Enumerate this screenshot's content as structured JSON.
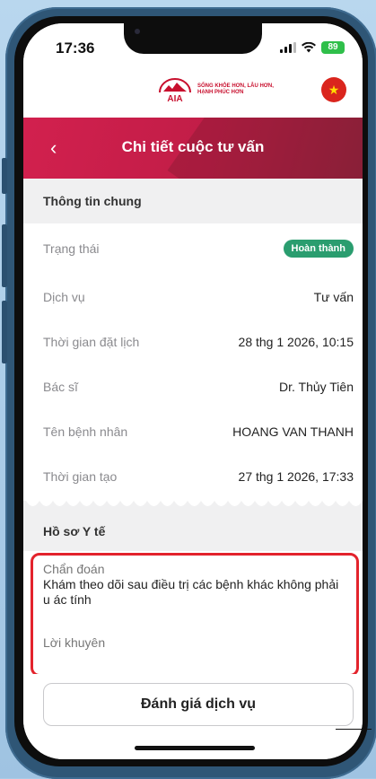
{
  "status_bar": {
    "time": "17:36",
    "battery": "89"
  },
  "brand": {
    "logo_text": "AIA",
    "tagline_line1": "SỐNG KHỎE HƠN, LÂU HƠN,",
    "tagline_line2": "HẠNH PHÚC HƠN",
    "flag_icon": "vietnam-flag-icon",
    "flag_glyph": "★"
  },
  "header": {
    "back_glyph": "‹",
    "title": "Chi tiết cuộc tư vấn"
  },
  "general": {
    "section_title": "Thông tin chung",
    "rows": [
      {
        "label": "Trạng thái",
        "value": "Hoàn thành",
        "type": "badge"
      },
      {
        "label": "Dịch vụ",
        "value": "Tư vấn"
      },
      {
        "label": "Thời gian đặt lịch",
        "value": "28 thg 1 2026, 10:15"
      },
      {
        "label": "Bác sĩ",
        "value": "Dr. Thủy Tiên"
      },
      {
        "label": "Tên bệnh nhân",
        "value": "HOANG VAN THANH"
      },
      {
        "label": "Thời gian tạo",
        "value": "27 thg 1 2026, 17:33"
      }
    ]
  },
  "medical": {
    "section_title": "Hồ sơ Y tế",
    "diagnosis_label": "Chẩn đoán",
    "diagnosis_text": "Khám theo dõi sau điều trị các bệnh khác không phải u ác tính",
    "advice_label": "Lời khuyên"
  },
  "footer": {
    "rate_button": "Đánh giá dịch vụ"
  },
  "colors": {
    "accent": "#d2204e",
    "success_badge": "#2a9d6f",
    "highlight_border": "#e3232c"
  }
}
